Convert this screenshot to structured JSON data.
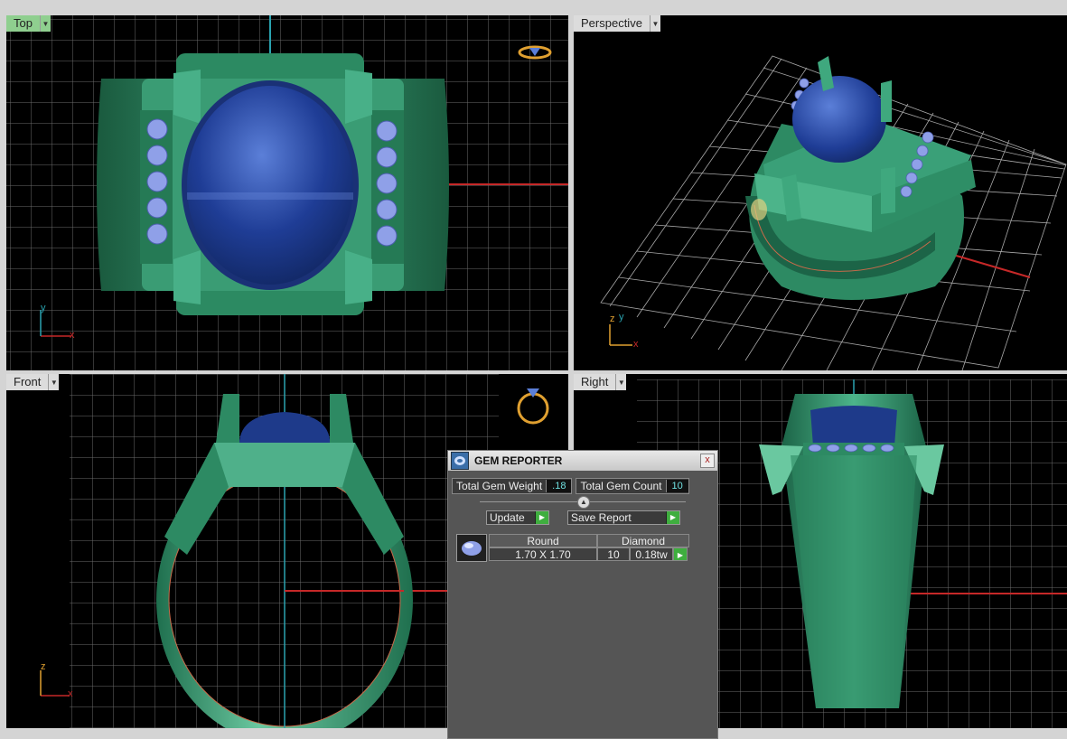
{
  "viewports": {
    "top": {
      "label": "Top",
      "axis_x": "x",
      "axis_y": "y"
    },
    "perspective": {
      "label": "Perspective",
      "axis_x": "x",
      "axis_y": "y",
      "axis_z": "z"
    },
    "front": {
      "label": "Front",
      "axis_x": "x",
      "axis_z": "z"
    },
    "right": {
      "label": "Right"
    }
  },
  "gem_reporter": {
    "title": "GEM REPORTER",
    "close_glyph": "x",
    "total_weight_label": "Total Gem Weight",
    "total_weight_value": ".18",
    "total_count_label": "Total Gem Count",
    "total_count_value": "10",
    "update_label": "Update",
    "save_report_label": "Save Report",
    "table": {
      "headers": [
        "Round",
        "Diamond"
      ],
      "row": {
        "size": "1.70 X 1.70",
        "count": "10",
        "weight": "0.18tw"
      }
    }
  },
  "colors": {
    "metal": "#2f8f66",
    "metal_light": "#5fbf98",
    "metal_dark": "#1a5a3e",
    "stone": "#1e3a8a",
    "stone_light": "#4a6ed0",
    "diamond": "#8fa0e8",
    "grid": "#8a8a8a",
    "axis_x": "#c62828",
    "axis_y": "#2aa3b0",
    "active_tab": "#8fcf8f"
  },
  "icons": [
    "ring-view-icon",
    "gem-reporter-icon",
    "dropdown-arrow-icon",
    "close-icon",
    "play-arrow-icon",
    "gem-thumbnail-icon"
  ]
}
